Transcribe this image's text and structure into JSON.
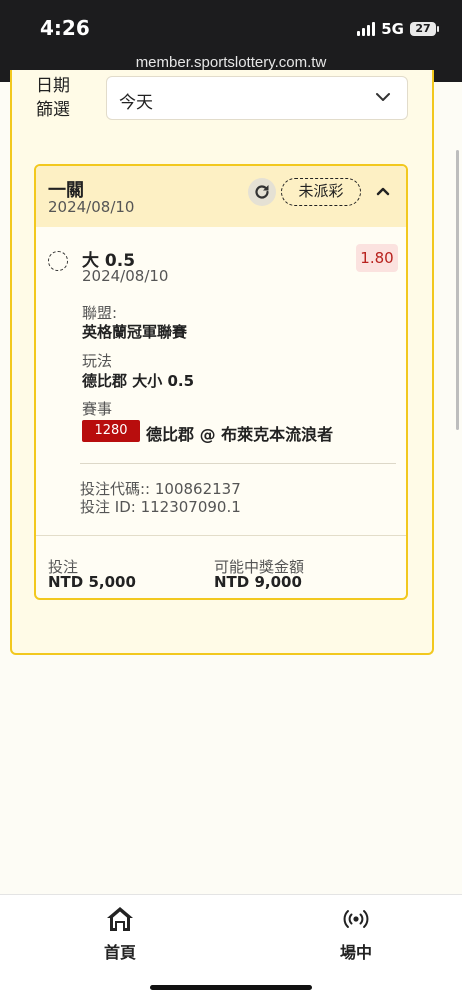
{
  "status_bar": {
    "time": "4:26",
    "network": "5G",
    "battery": "27",
    "url": "member.sportslottery.com.tw"
  },
  "filter": {
    "label": "日期\n篩選",
    "value": "今天"
  },
  "bet": {
    "type": "一關",
    "date": "2024/08/10",
    "status": "未派彩",
    "selection": "大 0.5",
    "selection_date": "2024/08/10",
    "odds": "1.80",
    "league_label": "聯盟:",
    "league": "英格蘭冠軍聯賽",
    "market_label": "玩法",
    "market": "德比郡 大小 0.5",
    "event_label": "賽事",
    "match_number": "1280",
    "match": "德比郡 @ 布萊克本流浪者",
    "bet_code": "投注代碼:: 100862137",
    "bet_id": "投注 ID: 112307090.1",
    "stake_label": "投注",
    "stake": "NTD 5,000",
    "payout_label": "可能中獎金額",
    "payout": "NTD 9,000"
  },
  "bottom_nav": [
    {
      "label": "首頁",
      "icon": "home-icon"
    },
    {
      "label": "場中",
      "icon": "live-icon"
    }
  ],
  "colors": {
    "accent": "#f2c81e",
    "header_bg": "#fdf0c4",
    "odds": "#b8221e",
    "match_badge": "#b80d0d"
  }
}
